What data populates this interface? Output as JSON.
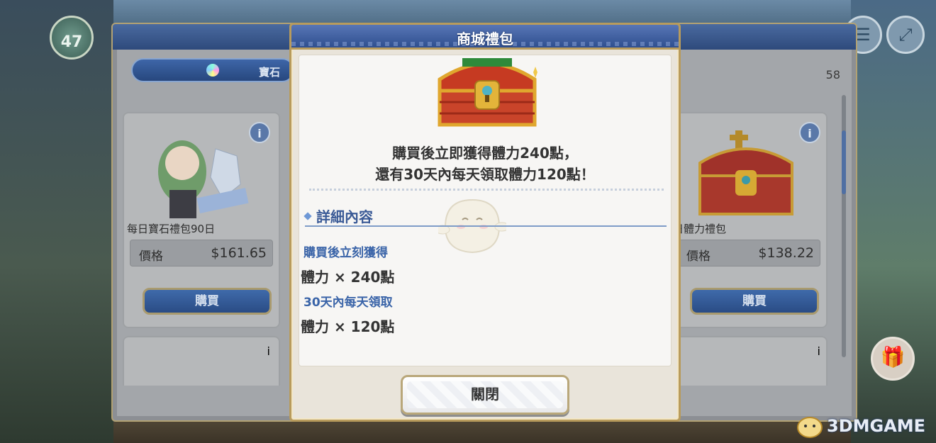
{
  "dialog": {
    "title": "商城禮包",
    "description_line1": "購買後立即獲得體力240點，",
    "description_line2": "還有30天內每天領取體力120點！",
    "section_title": "詳細內容",
    "immediate_heading": "購買後立刻獲得",
    "immediate_item": "體力 × 240點",
    "daily_heading": "30天內每天領取",
    "daily_item": "體力 × 120點",
    "close_label": "關閉"
  },
  "shop": {
    "tab_label": "寶石",
    "top_count": "58",
    "cards": [
      {
        "name": "每日寶石禮包90日",
        "price_label": "價格",
        "price": "$161.65",
        "buy_label": "購買"
      },
      {
        "name": "日體力禮包",
        "price_label": "價格",
        "price": "$138.22",
        "buy_label": "購買"
      }
    ]
  },
  "hud": {
    "stamina": "47"
  },
  "watermark": "3DMGAME"
}
